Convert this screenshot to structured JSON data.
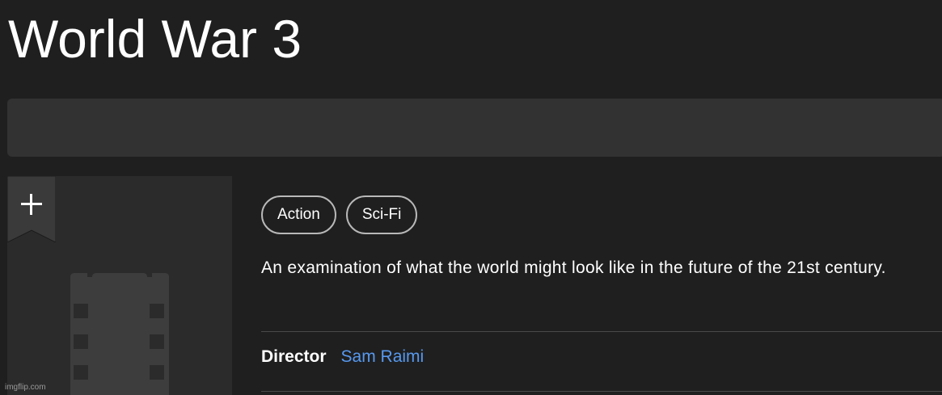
{
  "title": "World War 3",
  "genres": [
    "Action",
    "Sci-Fi"
  ],
  "plot": "An examination of what the world might look like in the future of the 21st century.",
  "credits": {
    "director_label": "Director",
    "director_name": "Sam Raimi"
  },
  "watchlist_icon": "plus-icon",
  "poster_placeholder_icon": "film-icon",
  "colors": {
    "background": "#1f1f1f",
    "panel": "#323232",
    "link": "#5799ef",
    "chip_border": "#b8b8b8"
  },
  "watermark": "imgflip.com"
}
